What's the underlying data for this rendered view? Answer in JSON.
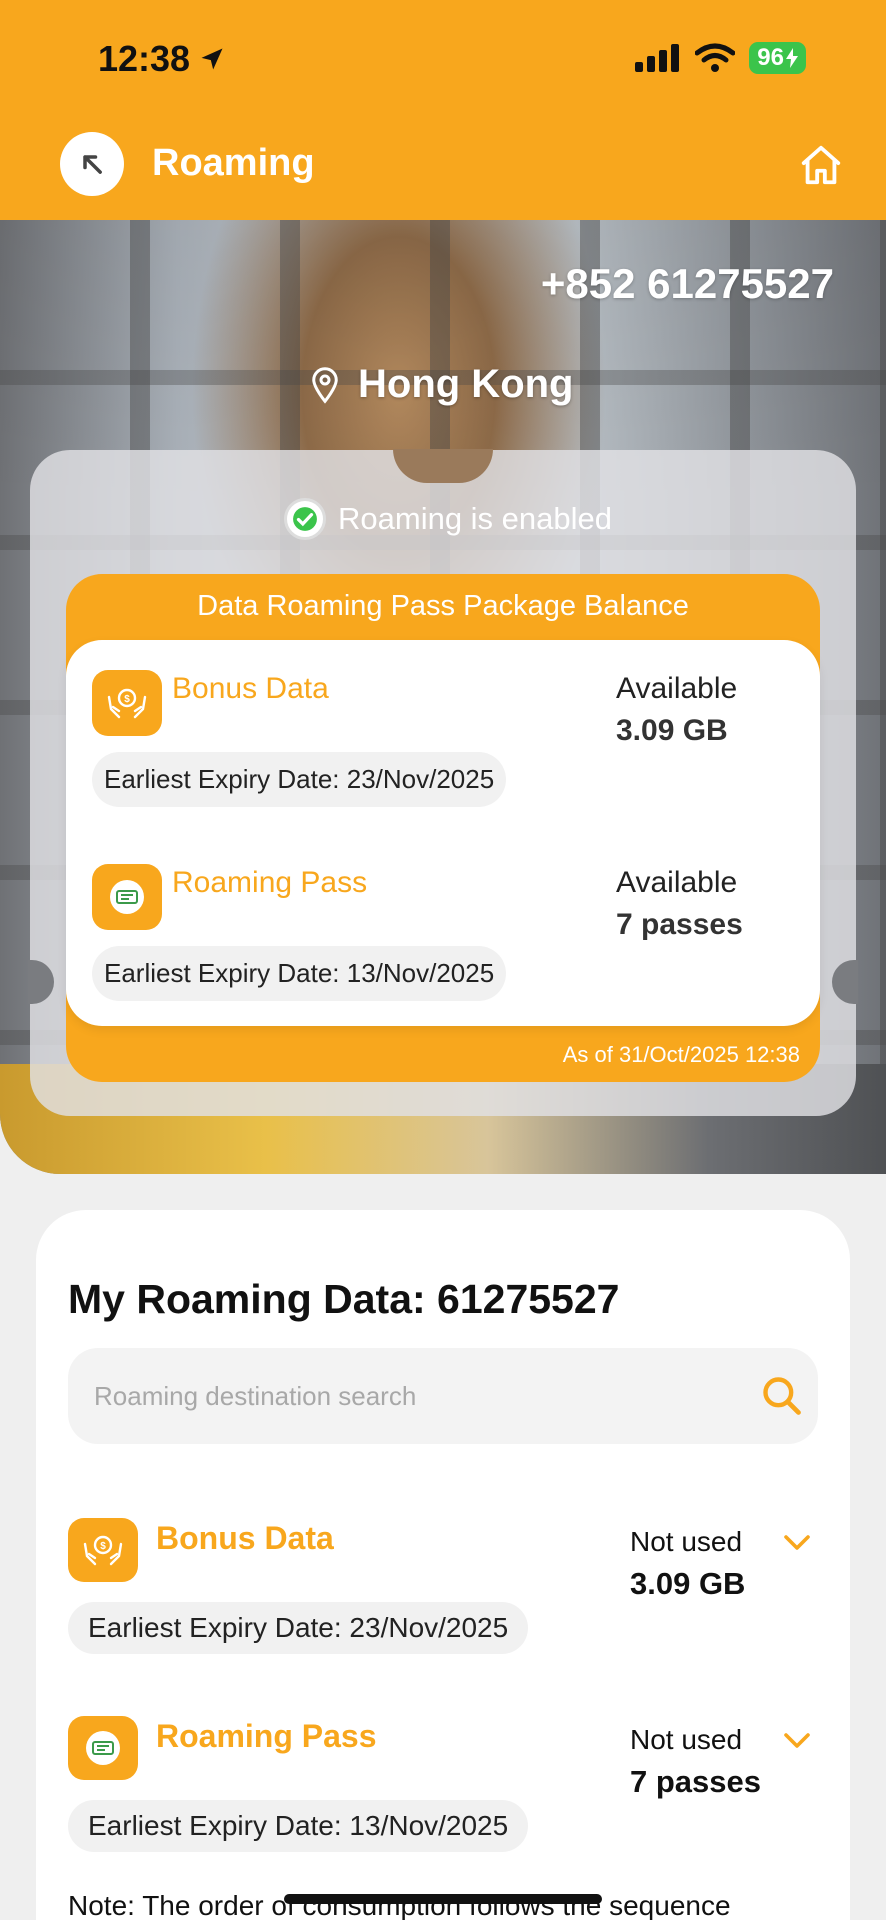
{
  "status_bar": {
    "time": "12:38",
    "battery": "96"
  },
  "nav": {
    "title": "Roaming"
  },
  "hero": {
    "phone_number": "+852 61275527",
    "location": "Hong Kong",
    "roaming_status": "Roaming is enabled"
  },
  "balance": {
    "title": "Data Roaming Pass Package Balance",
    "as_of": "As of 31/Oct/2025 12:38",
    "items": [
      {
        "name": "Bonus Data",
        "icon": "money-hands-icon",
        "expiry": "Earliest Expiry Date: 23/Nov/2025",
        "available_label": "Available",
        "value": "3.09 GB"
      },
      {
        "name": "Roaming Pass",
        "icon": "ticket-icon",
        "expiry": "Earliest Expiry Date: 13/Nov/2025",
        "available_label": "Available",
        "value": "7 passes"
      }
    ]
  },
  "my_data": {
    "title": "My Roaming Data: 61275527",
    "search_placeholder": "Roaming destination search",
    "items": [
      {
        "name": "Bonus Data",
        "icon": "money-hands-icon",
        "expiry": "Earliest Expiry Date: 23/Nov/2025",
        "status": "Not used",
        "value": "3.09 GB"
      },
      {
        "name": "Roaming Pass",
        "icon": "ticket-icon",
        "expiry": "Earliest Expiry Date: 13/Nov/2025",
        "status": "Not used",
        "value": "7 passes"
      }
    ],
    "note": "Note: The order of consumption follows the sequence"
  },
  "colors": {
    "brand": "#F8A71D",
    "success": "#3bc44b"
  }
}
